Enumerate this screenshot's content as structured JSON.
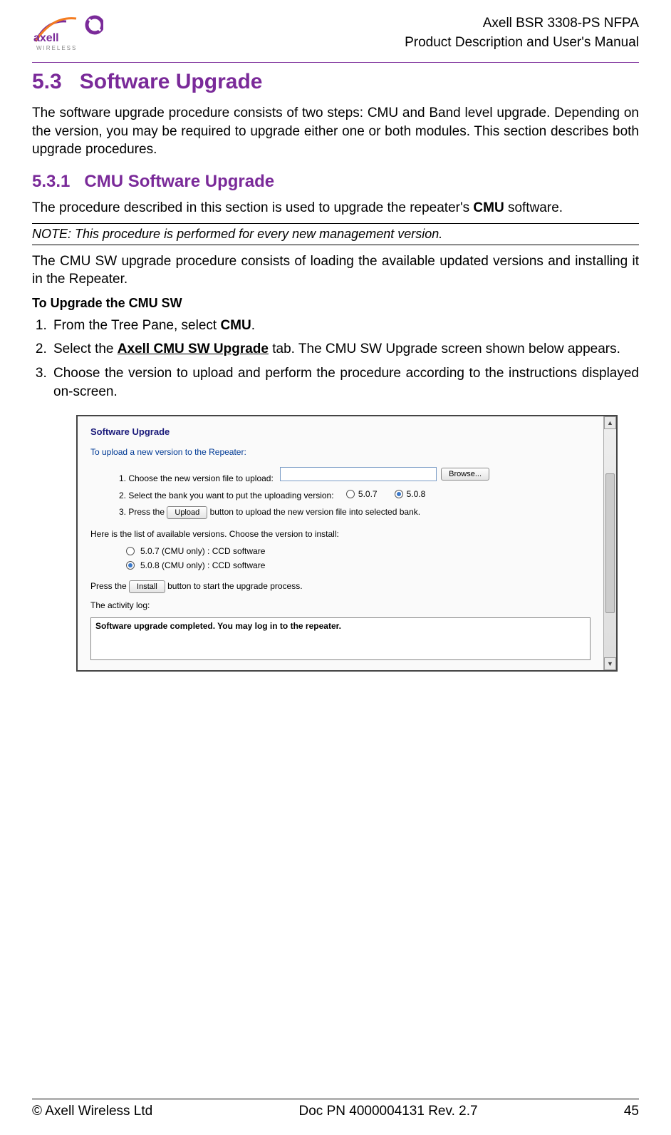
{
  "header": {
    "brand": "WIRELESS",
    "line1": "Axell BSR 3308-PS NFPA",
    "line2": "Product Description and User's Manual"
  },
  "section": {
    "num": "5.3",
    "title": "Software Upgrade",
    "intro": "The software upgrade procedure consists of two steps: CMU and Band level upgrade. Depending on the version, you may be required to upgrade either one or both modules. This section describes both upgrade procedures."
  },
  "subsection": {
    "num": "5.3.1",
    "title": "CMU Software Upgrade",
    "para1_pre": "The procedure described in this section is used to upgrade the repeater's ",
    "para1_bold": "CMU",
    "para1_post": " software.",
    "note": "NOTE: This procedure is performed for every new management version.",
    "para2": "The CMU SW upgrade procedure consists of loading the available updated versions and installing it in the Repeater.",
    "subhead": "To Upgrade the CMU SW",
    "steps": {
      "s1_pre": "From the Tree Pane, select ",
      "s1_bold": "CMU",
      "s1_post": ".",
      "s2_pre": "Select the ",
      "s2_bold": "Axell CMU SW Upgrade",
      "s2_post": " tab. The CMU SW Upgrade screen shown below appears.",
      "s3": "Choose the version to upload and perform the procedure according to the instructions displayed on-screen."
    }
  },
  "ui": {
    "heading": "Software Upgrade",
    "subtitle": "To upload a new version to the Repeater:",
    "step1": "1. Choose the new version file to upload:",
    "browse_label": "Browse...",
    "step2": "2. Select the bank you want to put the uploading version:",
    "bank_opt1": "5.0.7",
    "bank_opt2": "5.0.8",
    "step3_pre": "3. Press the ",
    "upload_label": "Upload",
    "step3_post": " button to upload the new version file into selected bank.",
    "choose_text": "Here is the list of available versions. Choose the version to install:",
    "ver1": "5.0.7 (CMU only) : CCD software",
    "ver2": "5.0.8 (CMU only) : CCD software",
    "install_pre": "Press the ",
    "install_label": "Install",
    "install_post": " button to start the upgrade process.",
    "activity_label": "The activity log:",
    "log_text": "Software upgrade completed. You may log in to the repeater."
  },
  "footer": {
    "copyright": "© Axell Wireless Ltd",
    "doc": "Doc PN 4000004131 Rev. 2.7",
    "page": "45"
  }
}
